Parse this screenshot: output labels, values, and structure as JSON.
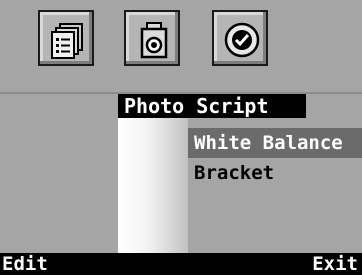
{
  "toolbar": {
    "buttons": [
      {
        "icon": "document-stack-icon"
      },
      {
        "icon": "camera-icon"
      },
      {
        "icon": "checkmark-circle-icon"
      }
    ]
  },
  "menu": {
    "title": "Photo Script",
    "items": [
      {
        "label": "White Balance",
        "selected": true
      },
      {
        "label": "Bracket",
        "selected": false
      }
    ]
  },
  "softkeys": {
    "left": "Edit",
    "right": "Exit"
  },
  "colors": {
    "background": "#a5a5a5",
    "selection": "#6b6b6b",
    "bar": "#000000"
  }
}
